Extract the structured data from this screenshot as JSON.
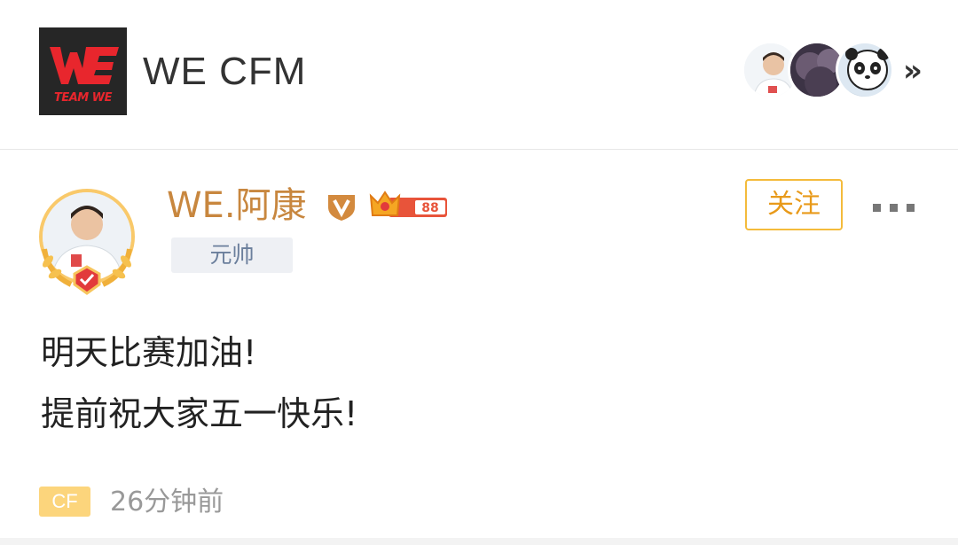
{
  "header": {
    "logo_caption": "TEAM WE",
    "title": "WE CFM",
    "avatars": [
      "member-avatar",
      "member-avatar",
      "panda-avatar"
    ],
    "more_icon": "double-chevron-right-icon",
    "more_glyph": "»"
  },
  "post": {
    "author": {
      "name": "WE.阿康",
      "verified_badge_icon": "v-shield-icon",
      "level_badge_text": "88",
      "rank_tag": "元帅"
    },
    "follow_label": "关注",
    "more_icon": "more-dots-icon",
    "content_lines": [
      "明天比赛加油!",
      "提前祝大家五一快乐!"
    ],
    "source_tag": "CF",
    "time": "26分钟前"
  },
  "colors": {
    "author_name": "#c8873f",
    "follow_border": "#f4bb3b",
    "logo_red": "#e8262d"
  }
}
